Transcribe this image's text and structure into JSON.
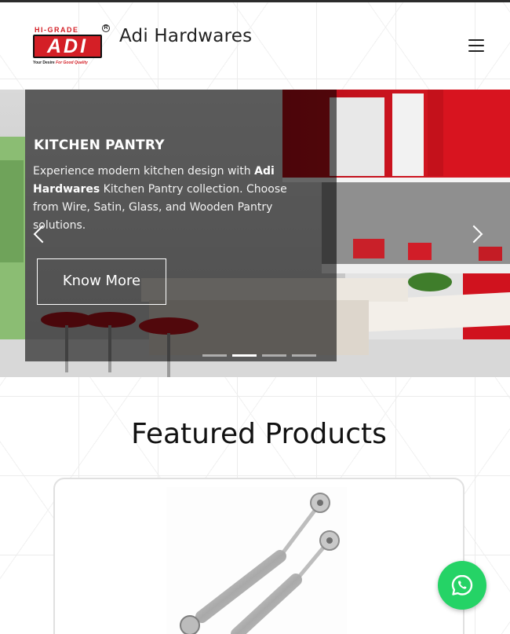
{
  "header": {
    "logo": {
      "top_text": "HI-GRADE",
      "mark_text": "ADI",
      "registered": "R",
      "tagline_black": "Your Desire",
      "tagline_red": "For Good Quality"
    },
    "brand_name": "Adi Hardwares",
    "menu_icon": "hamburger-menu-icon"
  },
  "hero": {
    "title": "KITCHEN PANTRY",
    "description_pre": "Experience modern kitchen design with ",
    "description_bold": "Adi Hardwares",
    "description_post": " Kitchen Pantry collection. Choose from Wire, Satin, Glass, and Wooden Pantry solutions.",
    "button_label": "Know More",
    "prev_icon": "chevron-left-icon",
    "next_icon": "chevron-right-icon",
    "slide_count": 4,
    "active_slide": 2
  },
  "featured": {
    "heading": "Featured Products"
  },
  "whatsapp": {
    "icon": "whatsapp-icon"
  },
  "colors": {
    "brand_red": "#d41f26",
    "whatsapp_green": "#25d366",
    "kitchen_red": "#d31420"
  }
}
